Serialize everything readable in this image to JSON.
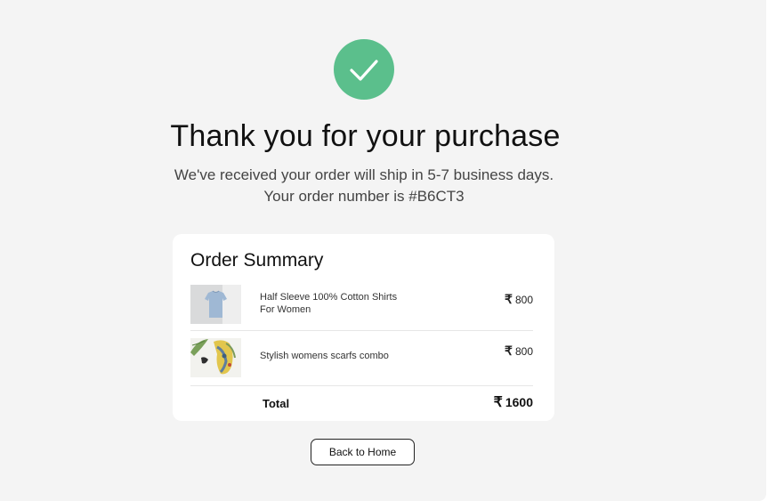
{
  "confirmation": {
    "icon": "check-icon",
    "title": "Thank you for your purchase",
    "message_line1": "We've received your order will ship in 5-7 business days.",
    "message_line2": "Your order number is #B6CT3"
  },
  "order_summary": {
    "heading": "Order Summary",
    "currency_symbol": "₹",
    "items": [
      {
        "name_line1": "Half Sleeve 100% Cotton Shirts",
        "name_line2": "For Women",
        "price": "800",
        "image": "shirt-thumbnail"
      },
      {
        "name_line1": "Stylish womens scarfs combo",
        "price": "800",
        "image": "scarves-thumbnail"
      }
    ],
    "total_label": "Total",
    "total_value": "1600"
  },
  "actions": {
    "back_label": "Back to Home"
  },
  "colors": {
    "page_background": "#f4f4f4",
    "success_green": "#5bbf8c",
    "card_background": "#ffffff",
    "text_primary": "#111111"
  }
}
